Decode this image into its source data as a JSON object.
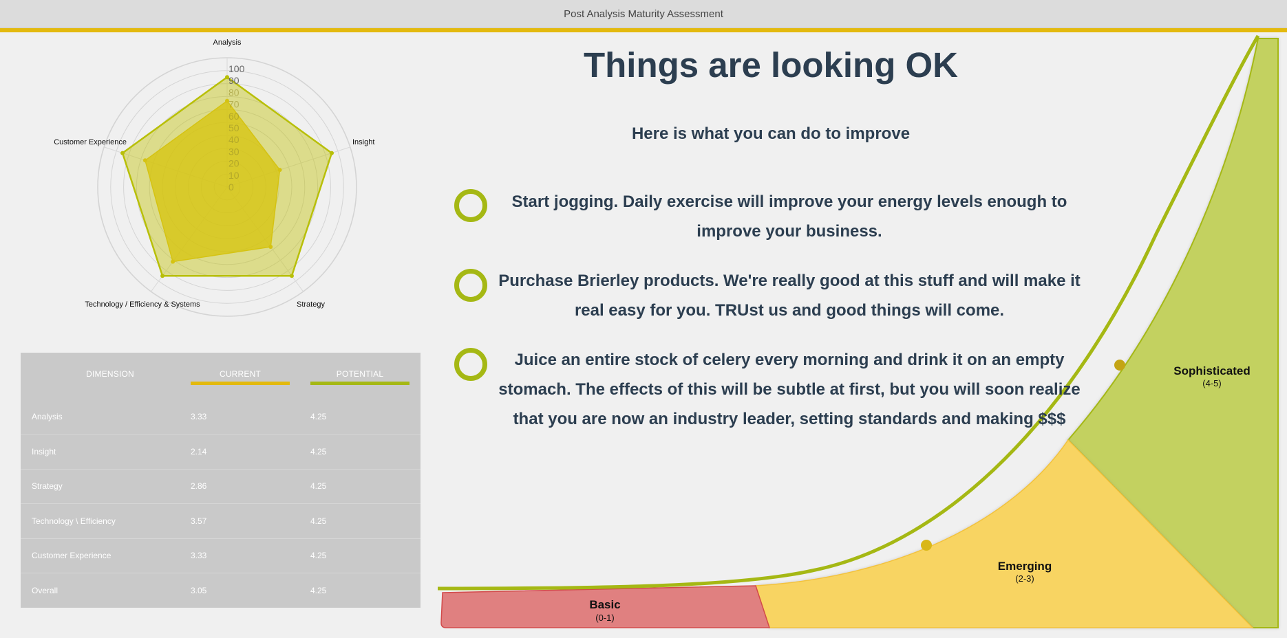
{
  "window": {
    "title": "Post Analysis Maturity Assessment"
  },
  "colors": {
    "accent": "#e3b90e",
    "current_color": "#e3b90e",
    "potential_color": "#a5b814",
    "basic_fill": "#e08080",
    "emerging_fill": "#f8d462",
    "sophisticated_fill": "#c3d160"
  },
  "radar": {
    "axes": [
      "Analysis",
      "Insight",
      "Strategy",
      "Technology / Efficiency & Systems",
      "Customer Experience"
    ],
    "ticks": [
      "100",
      "90",
      "80",
      "70",
      "60",
      "50",
      "40",
      "30",
      "20",
      "10",
      "0"
    ],
    "rmax": 100
  },
  "chart_data": {
    "type": "radar",
    "categories": [
      "Analysis",
      "Insight",
      "Strategy",
      "Technology / Efficiency & Systems",
      "Customer Experience"
    ],
    "rlim": [
      0,
      100
    ],
    "series": [
      {
        "values": [
          66.6,
          42.8,
          57.2,
          71.4,
          66.6
        ]
      },
      {
        "values": [
          85,
          85,
          85,
          85,
          85
        ]
      }
    ]
  },
  "table": {
    "headers": [
      "DIMENSION",
      "CURRENT",
      "POTENTIAL"
    ],
    "rows": [
      {
        "dimension": "Analysis",
        "current": "3.33",
        "potential": "4.25"
      },
      {
        "dimension": "Insight",
        "current": "2.14",
        "potential": "4.25"
      },
      {
        "dimension": "Strategy",
        "current": "2.86",
        "potential": "4.25"
      },
      {
        "dimension": "Technology \\ Efficiency",
        "current": "3.57",
        "potential": "4.25"
      },
      {
        "dimension": "Customer Experience",
        "current": "3.33",
        "potential": "4.25"
      },
      {
        "dimension": "Overall",
        "current": "3.05",
        "potential": "4.25"
      }
    ]
  },
  "main": {
    "headline": "Things are looking OK",
    "subheadline": "Here is what you can do to improve",
    "tips": [
      {
        "icon": "ring-icon",
        "line1": "Start jogging. Daily exercise will improve your energy levels enough to",
        "line2": "improve your business.",
        "line3": ""
      },
      {
        "icon": "ring-icon",
        "line1": "Purchase Brierley products. We're really good at this stuff and will make it",
        "line2": "real easy for you. TRUst us and good things will come.",
        "line3": ""
      },
      {
        "icon": "ring-icon",
        "line1": "Juice an entire stock of celery every morning and drink it on an empty",
        "line2": "stomach. The effects of this will be subtle at first, but you will soon realize",
        "line3": "that you are now an industry leader, setting standards and making $$$"
      }
    ]
  },
  "maturity": {
    "levels": [
      {
        "name": "Basic",
        "range": "(0-1)"
      },
      {
        "name": "Emerging",
        "range": "(2-3)"
      },
      {
        "name": "Sophisticated",
        "range": "(4-5)"
      }
    ]
  }
}
